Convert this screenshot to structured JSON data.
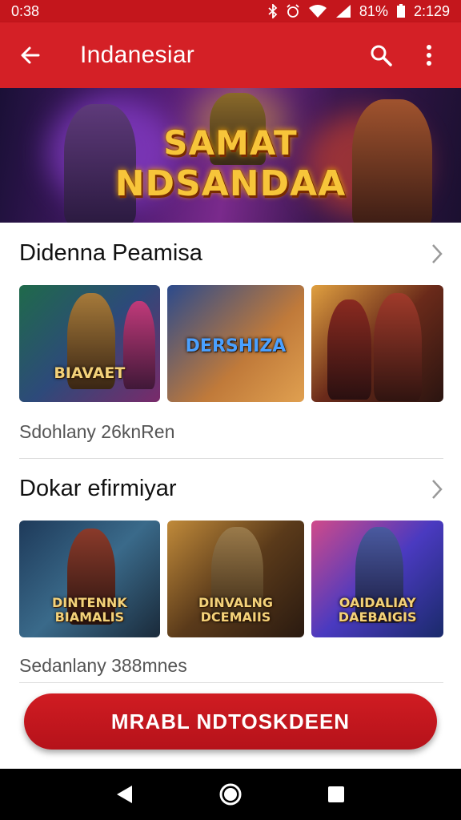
{
  "status_bar": {
    "time_left": "0:38",
    "battery": "81%",
    "time_right": "2:129"
  },
  "app_bar": {
    "title": "Indanesiar",
    "back_icon": "arrow-left-icon",
    "search_icon": "search-icon",
    "menu_icon": "more-vert-icon"
  },
  "banner": {
    "line1": "SAMAT",
    "line2": "NDSANDAA"
  },
  "sections": [
    {
      "title": "Didenna Peamisa",
      "meta": "Sdohlany 26knRen",
      "thumbs": [
        {
          "caption": "BIAVAET"
        },
        {
          "caption": "DERSHIZA"
        },
        {
          "caption": ""
        }
      ]
    },
    {
      "title": "Dokar efirmiyar",
      "meta": "Sedanlany 388mnes",
      "thumbs": [
        {
          "caption": "DINTENNK BIAMALIS"
        },
        {
          "caption": "DINVALNG DCEMAIIS"
        },
        {
          "caption": "OAIDALIAY DAEBAIGIS"
        }
      ]
    }
  ],
  "cta": {
    "label": "MRABL NDTOSKDEEN"
  },
  "nav": {
    "back": "triangle-back-icon",
    "home": "circle-home-icon",
    "recents": "square-recents-icon"
  },
  "colors": {
    "primary": "#d42026",
    "status": "#c4161c"
  }
}
